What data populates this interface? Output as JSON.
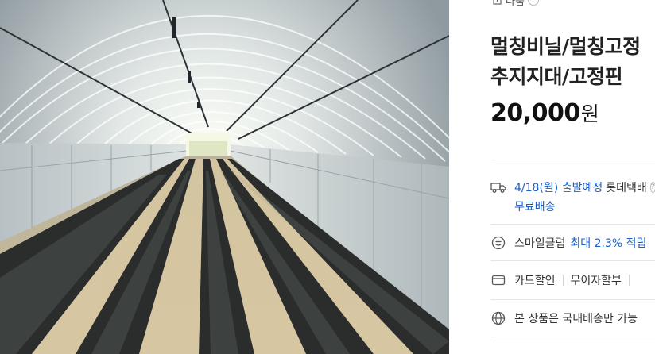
{
  "header": {
    "share_label": "나눔",
    "help_glyph": "?"
  },
  "product": {
    "title_line1": "멀칭비닐/멀칭고정",
    "title_line2": "추지지대/고정핀",
    "price": "20,000",
    "currency": "원"
  },
  "delivery": {
    "icon": "truck-icon",
    "date": "4/18(월) 출발예정",
    "carrier": "롯데택배",
    "help_glyph": "?",
    "free_shipping": "무료배송"
  },
  "smile_club": {
    "icon": "smile-icon",
    "label": "스마일클럽",
    "highlight": "최대 2.3% 적립"
  },
  "payment": {
    "icon": "card-icon",
    "card_discount": "카드할인",
    "installment": "무이자할부"
  },
  "shipping_notice": {
    "icon": "globe-icon",
    "text": "본 상품은 국내배송만 가능"
  },
  "colors": {
    "accent_blue": "#1a5fc9",
    "text_dark": "#222222",
    "divider": "#e5e5e5"
  }
}
